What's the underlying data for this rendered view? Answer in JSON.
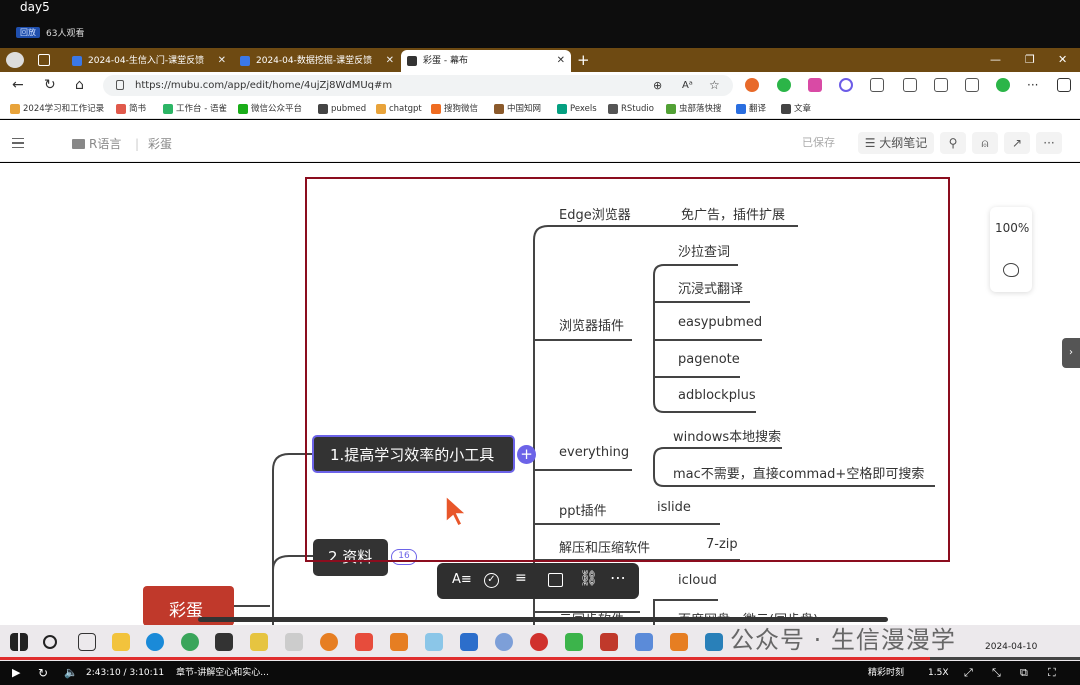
{
  "video": {
    "title": "day5",
    "live_tag": "回放",
    "viewers": "63人观看"
  },
  "browser": {
    "tabs": [
      {
        "title": "2024-04-生信入门-课堂反馈"
      },
      {
        "title": "2024-04-数据挖掘-课堂反馈"
      },
      {
        "title": "彩蛋 - 幕布"
      }
    ],
    "new_tab": "+",
    "url": "https://mubu.com/app/edit/home/4ujZj8WdMUq#m",
    "bookmarks": [
      {
        "label": "2024学习和工作记录",
        "color": "#e8a33a"
      },
      {
        "label": "简书",
        "color": "#e0594b"
      },
      {
        "label": "工作台 - 语雀",
        "color": "#2cb565"
      },
      {
        "label": "微信公众平台",
        "color": "#1aad19"
      },
      {
        "label": "pubmed",
        "color": "#444444"
      },
      {
        "label": "chatgpt",
        "color": "#e8a33a"
      },
      {
        "label": "搜狗微信",
        "color": "#ef6c21"
      },
      {
        "label": "中国知网",
        "color": "#8b5a2b"
      },
      {
        "label": "Pexels",
        "color": "#05a081"
      },
      {
        "label": "RStudio",
        "color": "#555555"
      },
      {
        "label": "虫部落快搜",
        "color": "#52a135"
      },
      {
        "label": "翻译",
        "color": "#2a6ee0"
      },
      {
        "label": "文章",
        "color": "#444444"
      }
    ]
  },
  "app": {
    "breadcrumb_folder": "R语言",
    "breadcrumb_doc": "彩蛋",
    "saved": "已保存",
    "outline_btn": "大纲笔记"
  },
  "canvas": {
    "zoom": "100%",
    "root_node": "彩蛋",
    "main_nodes": [
      {
        "label": "1.提高学习效率的小工具"
      },
      {
        "label": "2.资料",
        "badge": "16"
      }
    ],
    "branches": {
      "edge": "Edge浏览器",
      "edge_note": "免广告，插件扩展",
      "plugins": "浏览器插件",
      "plugin_items": [
        "沙拉查词",
        "沉浸式翻译",
        "easypubmed",
        "pagenote",
        "adblockplus"
      ],
      "everything": "everything",
      "everything_items": [
        "windows本地搜索",
        "mac不需要，直接commad+空格即可搜索"
      ],
      "ppt": "ppt插件",
      "ppt_item": "islide",
      "zip": "解压和压缩软件",
      "zip_item": "7-zip",
      "cloud": "云同步软件",
      "cloud_items": [
        "icloud",
        "百度网盘、微云(同步盘)"
      ]
    }
  },
  "taskbar": {
    "watermark": "公众号 · 生信漫漫学",
    "clock_date": "2024-04-10"
  },
  "player": {
    "time": "2:43:10 / 3:10:11",
    "chapter": "章节-讲解空心和实心...",
    "highlight": "精彩时刻",
    "speed": "1.5X",
    "progress": 0.861
  }
}
